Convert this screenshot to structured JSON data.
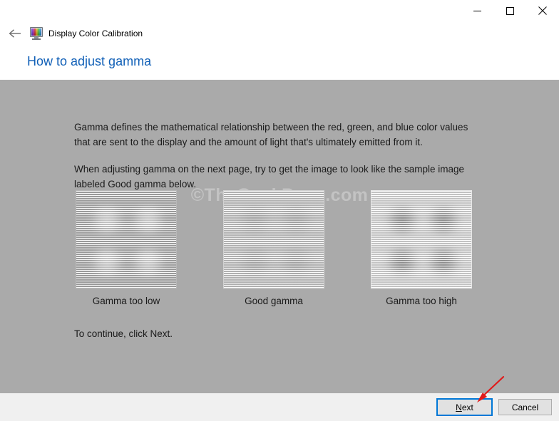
{
  "window": {
    "app_title": "Display Color Calibration",
    "app_icon": "monitor-color-icon",
    "back_icon": "back-arrow-icon",
    "controls": {
      "minimize": "minimize-icon",
      "maximize": "maximize-icon",
      "close": "close-icon"
    }
  },
  "page": {
    "heading": "How to adjust gamma",
    "paragraph1": "Gamma defines the mathematical relationship between the red, green, and blue color values that are sent to the display and the amount of light that's ultimately emitted from it.",
    "paragraph2": "When adjusting gamma on the next page, try to get the image to look like the sample image labeled Good gamma below.",
    "paragraph3": "To continue, click Next."
  },
  "samples": [
    {
      "label": "Gamma too low",
      "variant": "gamma-low"
    },
    {
      "label": "Good gamma",
      "variant": "gamma-good"
    },
    {
      "label": "Gamma too high",
      "variant": "gamma-high"
    }
  ],
  "watermark": "©TheGeekPage.com",
  "footer": {
    "next_label_prefix": "",
    "next_accel": "N",
    "next_label_rest": "ext",
    "next_label": "Next",
    "cancel_label": "Cancel"
  },
  "annotation": {
    "arrow": "red-arrow-pointing-to-next-button",
    "color": "#e01b1b"
  },
  "colors": {
    "content_background": "#aaaaaa",
    "footer_background": "#f0f0f0",
    "heading_text": "#1160b7",
    "focus_border": "#0078d7",
    "button_face": "#e1e1e1",
    "annotation_red": "#e01b1b"
  }
}
